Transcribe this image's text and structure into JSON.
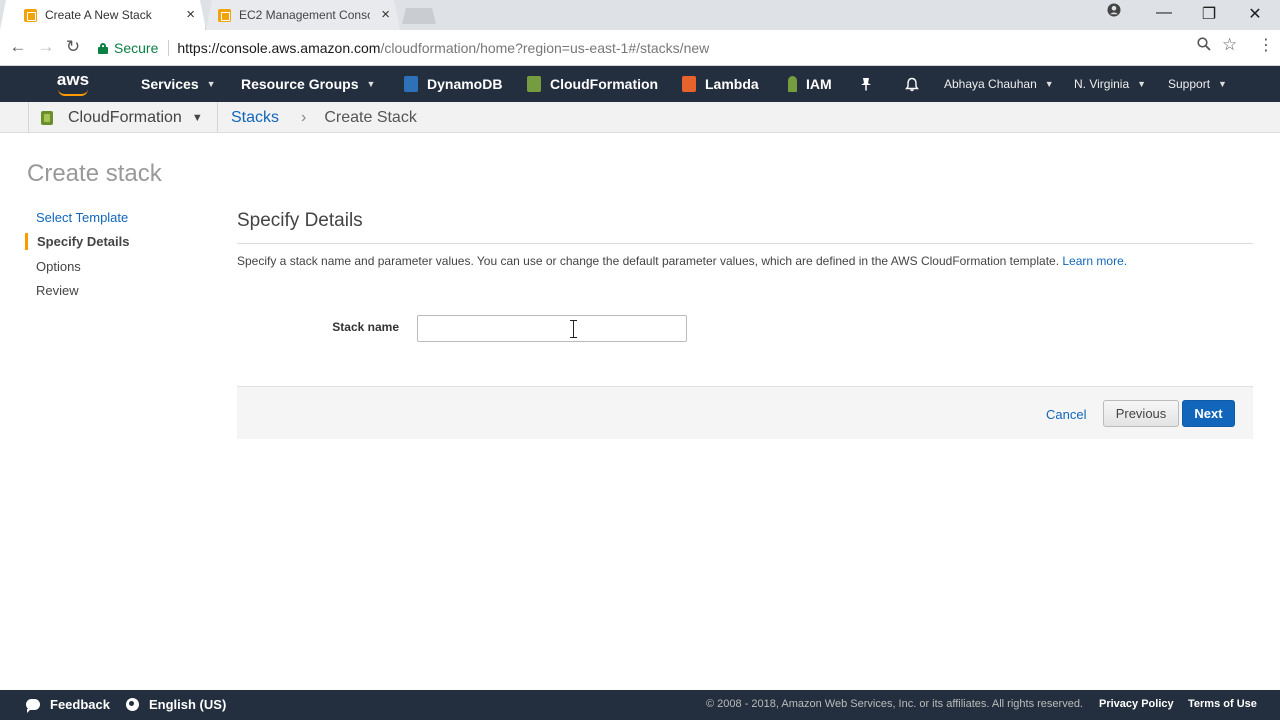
{
  "browser": {
    "tabs": [
      {
        "title": "Create A New Stack",
        "active": true
      },
      {
        "title": "EC2 Management Conso",
        "active": false
      }
    ],
    "address": {
      "security_label": "Secure",
      "url_base": "https://console.aws.amazon.com",
      "url_rest": "/cloudformation/home?region=us-east-1#/stacks/new"
    },
    "window_controls": {
      "minimize": "—",
      "restore": "❐",
      "close": "✕"
    }
  },
  "aws_nav": {
    "logo_text": "aws",
    "services_label": "Services",
    "resource_groups_label": "Resource Groups",
    "shortcuts": [
      {
        "label": "DynamoDB",
        "color": "#2d72b8"
      },
      {
        "label": "CloudFormation",
        "color": "#759c3e"
      },
      {
        "label": "Lambda",
        "color": "#e8622c"
      },
      {
        "label": "IAM",
        "color": "#759c3e"
      }
    ],
    "user_label": "Abhaya Chauhan",
    "region_label": "N. Virginia",
    "support_label": "Support"
  },
  "subnav": {
    "service_label": "CloudFormation",
    "breadcrumb_link": "Stacks",
    "breadcrumb_separator": "›",
    "breadcrumb_current": "Create Stack"
  },
  "page": {
    "title": "Create stack",
    "wizard_steps": [
      {
        "label": "Select Template",
        "state": "link"
      },
      {
        "label": "Specify Details",
        "state": "active"
      },
      {
        "label": "Options",
        "state": "plain"
      },
      {
        "label": "Review",
        "state": "plain"
      }
    ],
    "section_title": "Specify Details",
    "section_description": "Specify a stack name and parameter values. You can use or change the default parameter values, which are defined in the AWS CloudFormation template.",
    "learn_more_label": "Learn more.",
    "stack_name_label": "Stack name",
    "stack_name_value": "",
    "buttons": {
      "cancel": "Cancel",
      "previous": "Previous",
      "next": "Next"
    }
  },
  "footer": {
    "feedback_label": "Feedback",
    "language_label": "English (US)",
    "copyright": "© 2008 - 2018, Amazon Web Services, Inc. or its affiliates. All rights reserved.",
    "privacy_label": "Privacy Policy",
    "terms_label": "Terms of Use"
  },
  "colors": {
    "nav_bg": "#232f3e",
    "link": "#1166bb",
    "accent": "#ff9900",
    "secure_green": "#0b8043"
  }
}
